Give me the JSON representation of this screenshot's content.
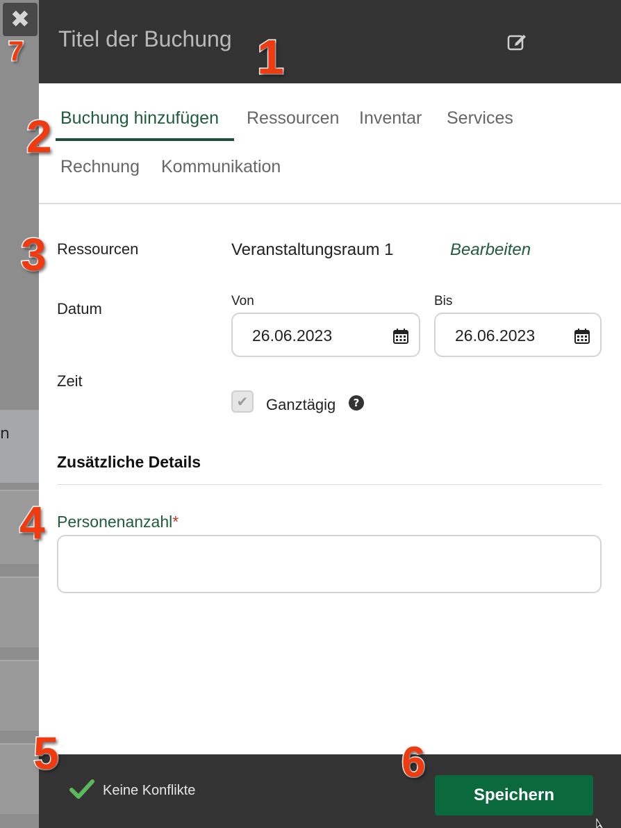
{
  "header": {
    "title": "Titel der Buchung"
  },
  "tabs": [
    {
      "label": "Buchung hinzufügen",
      "active": true
    },
    {
      "label": "Ressourcen",
      "active": false
    },
    {
      "label": "Inventar",
      "active": false
    },
    {
      "label": "Services",
      "active": false
    },
    {
      "label": "Rechnung",
      "active": false
    },
    {
      "label": "Kommunikation",
      "active": false
    }
  ],
  "form": {
    "resources_label": "Ressourcen",
    "resources_value": "Veranstaltungsraum 1",
    "edit_link": "Bearbeiten",
    "date_label": "Datum",
    "from_label": "Von",
    "from_value": "26.06.2023",
    "to_label": "Bis",
    "to_value": "26.06.2023",
    "time_label": "Zeit",
    "all_day_label": "Ganztägig",
    "all_day_checked": true,
    "help_glyph": "?",
    "details_title": "Zusätzliche Details",
    "people_label": "Personenanzahl",
    "people_required_mark": "*",
    "people_value": ""
  },
  "footer": {
    "status": "Keine Konflikte",
    "save_label": "Speichern"
  },
  "close_glyph": "✖",
  "background_fragment": "n",
  "callouts": [
    "1",
    "2",
    "3",
    "4",
    "5",
    "6",
    "7"
  ],
  "colors": {
    "header_bg": "#333333",
    "accent_green": "#1f5c3a",
    "save_button": "#0a6a3e",
    "callout_red": "#f03a10",
    "status_check": "#5cb85c"
  },
  "icons": [
    "close-icon",
    "edit-icon",
    "calendar-icon",
    "checkmark-icon",
    "help-icon"
  ]
}
